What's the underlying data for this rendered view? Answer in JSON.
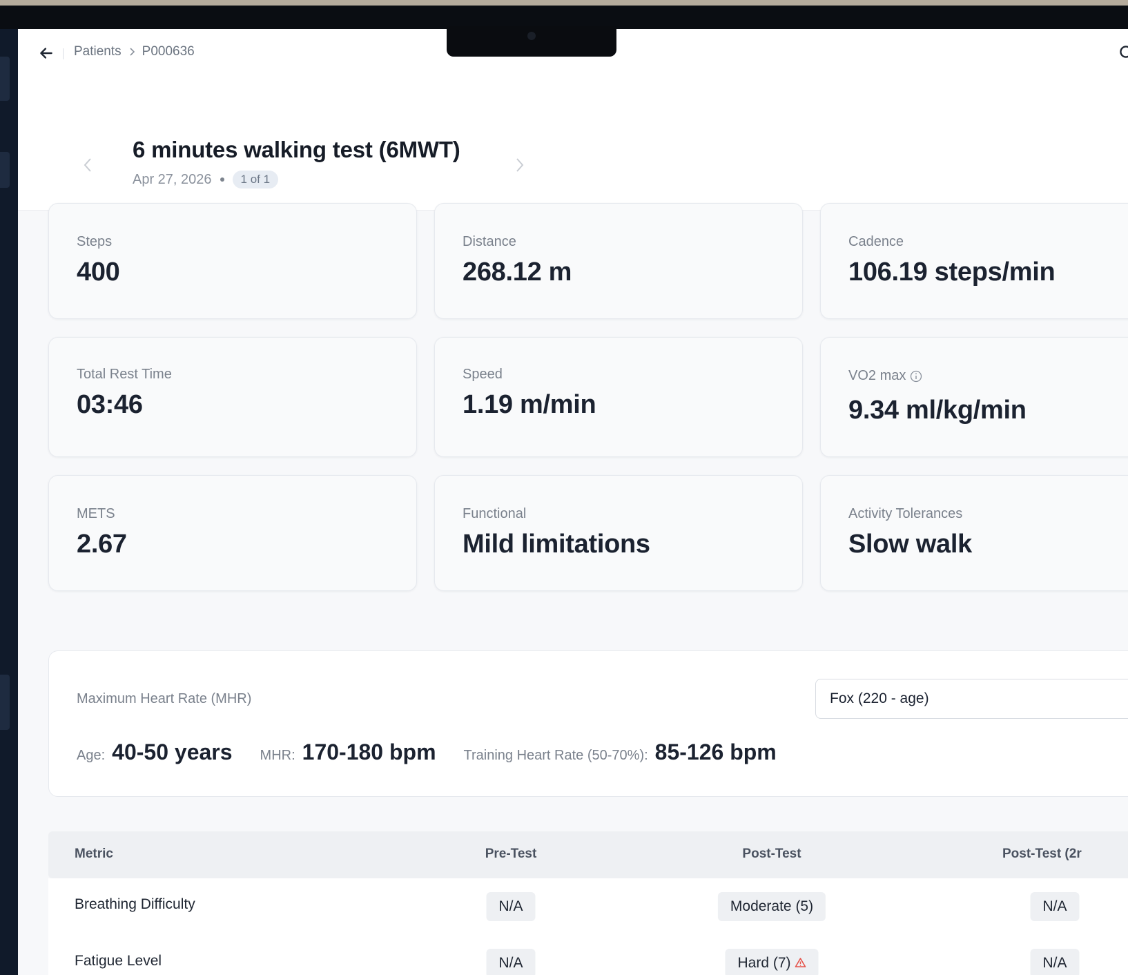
{
  "breadcrumb": {
    "root": "Patients",
    "current": "P000636"
  },
  "test": {
    "title": "6 minutes walking test (6MWT)",
    "date": "Apr 27, 2026",
    "position": "1 of 1"
  },
  "metrics": {
    "steps": {
      "label": "Steps",
      "value": "400"
    },
    "distance": {
      "label": "Distance",
      "value": "268.12 m"
    },
    "cadence": {
      "label": "Cadence",
      "value": "106.19 steps/min"
    },
    "rest_time": {
      "label": "Total Rest Time",
      "value": "03:46"
    },
    "speed": {
      "label": "Speed",
      "value": "1.19 m/min"
    },
    "vo2max": {
      "label": "VO2 max",
      "value": "9.34 ml/kg/min"
    },
    "mets": {
      "label": "METS",
      "value": "2.67"
    },
    "functional": {
      "label": "Functional",
      "value": "Mild limitations"
    },
    "activity": {
      "label": "Activity Tolerances",
      "value": "Slow walk"
    }
  },
  "mhr": {
    "title": "Maximum Heart Rate (MHR)",
    "formula": "Fox (220 - age)",
    "age_label": "Age:",
    "age_value": "40-50 years",
    "mhr_label": "MHR:",
    "mhr_value": "170-180 bpm",
    "thr_label": "Training Heart Rate (50-70%):",
    "thr_value": "85-126 bpm"
  },
  "table": {
    "headers": [
      "Metric",
      "Pre-Test",
      "Post-Test",
      "Post-Test (2r"
    ],
    "rows": [
      {
        "metric": "Breathing Difficulty",
        "pre": "N/A",
        "post": "Moderate (5)",
        "post2": "N/A"
      },
      {
        "metric": "Fatigue Level",
        "pre": "N/A",
        "post": "Hard (7)",
        "post2": "N/A"
      }
    ]
  },
  "icons": {
    "back": "arrow-left-icon",
    "warning": "warning-triangle-icon",
    "info": "info-icon"
  },
  "colors": {
    "warning": "#e5534b",
    "chip_bg": "#eef0f3"
  }
}
